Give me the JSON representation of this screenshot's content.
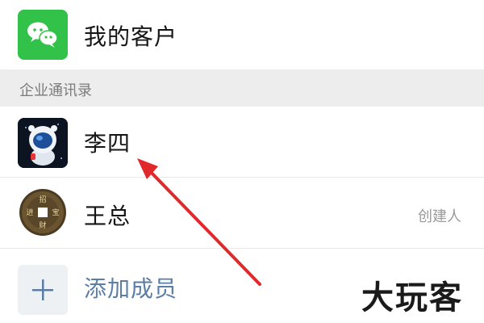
{
  "header": {
    "title": "我的客户",
    "icon": "wechat-icon"
  },
  "section": {
    "label": "企业通讯录"
  },
  "contacts": [
    {
      "name": "李四",
      "role": "",
      "avatar": "astronaut-avatar"
    },
    {
      "name": "王总",
      "role": "创建人",
      "avatar": "coin-avatar"
    }
  ],
  "add_member": {
    "label": "添加成员",
    "icon": "plus-icon"
  },
  "watermark": "大玩客",
  "colors": {
    "wechat_green": "#32c24a",
    "arrow_red": "#e1282b",
    "link_blue": "#5b7da6"
  }
}
